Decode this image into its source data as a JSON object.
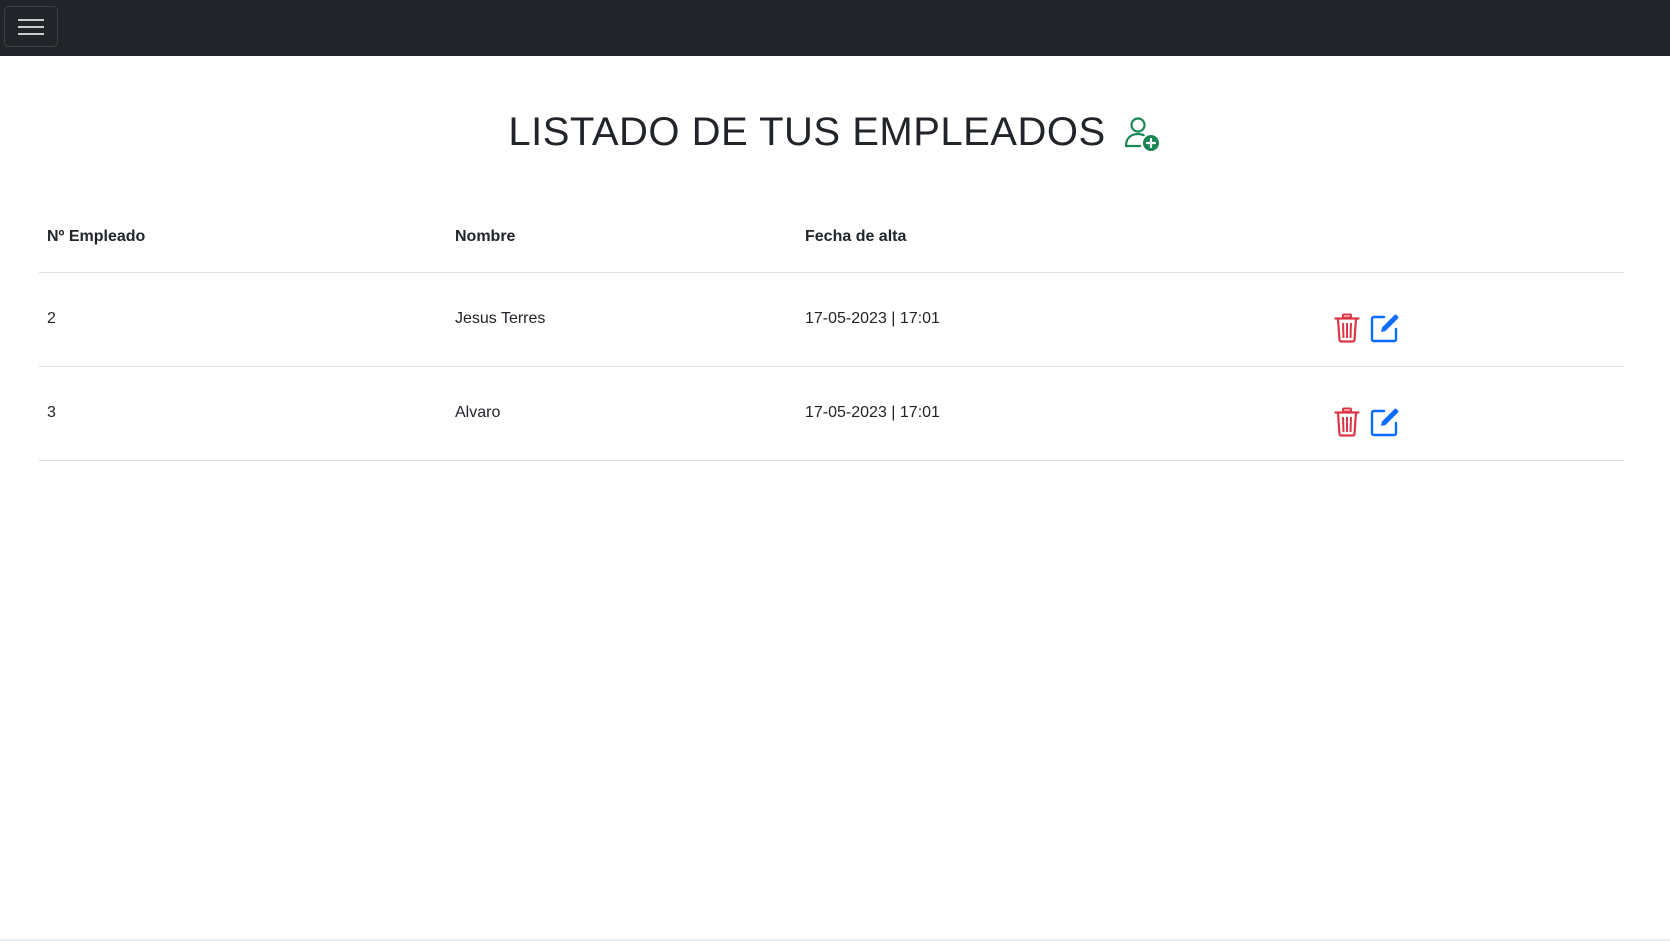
{
  "navbar": {
    "menu_icon": "hamburger-icon"
  },
  "page": {
    "title": "LISTADO DE TUS EMPLEADOS",
    "add_icon": "person-plus-icon",
    "add_icon_color": "#198754"
  },
  "table": {
    "headers": [
      "Nº Empleado",
      "Nombre",
      "Fecha de alta",
      ""
    ],
    "rows": [
      {
        "id": "2",
        "nombre": "Jesus Terres",
        "fecha": "17-05-2023 | 17:01"
      },
      {
        "id": "3",
        "nombre": "Alvaro",
        "fecha": "17-05-2023 | 17:01"
      }
    ],
    "delete_icon": "trash-icon",
    "delete_color": "#dc3545",
    "edit_icon": "pencil-square-icon",
    "edit_color": "#0d6efd"
  }
}
